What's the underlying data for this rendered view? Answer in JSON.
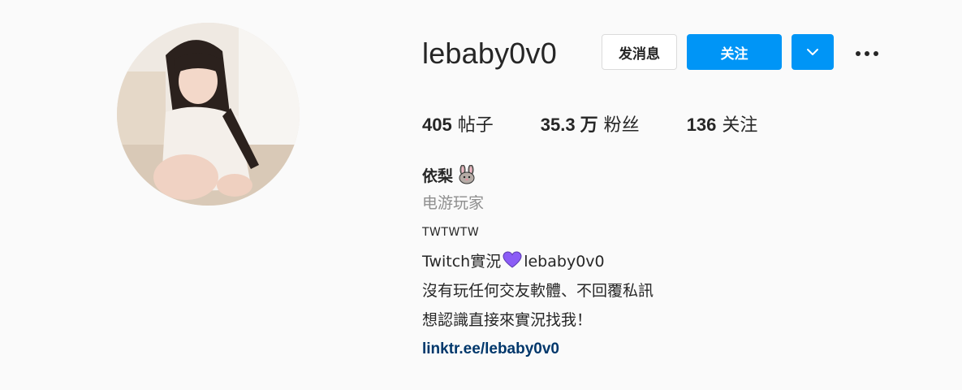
{
  "profile": {
    "username": "lebaby0v0",
    "full_name": "依梨",
    "category": "电游玩家",
    "bio_lines": {
      "line1": "TWTWTW",
      "line2_prefix": "Twitch實況",
      "line2_suffix": "lebaby0v0",
      "line3": "沒有玩任何交友軟體、不回覆私訊",
      "line4": "想認識直接來實況找我！"
    },
    "link": "linktr.ee/lebaby0v0"
  },
  "actions": {
    "message_label": "发消息",
    "follow_label": "关注"
  },
  "stats": {
    "posts_count": "405",
    "posts_label": "帖子",
    "followers_count": "35.3 万",
    "followers_label": "粉丝",
    "following_count": "136",
    "following_label": "关注"
  },
  "icons": {
    "dropdown": "chevron-down-icon",
    "more": "more-options-icon",
    "name_emoji": "rabbit-emoji-icon",
    "bio_emoji": "purple-heart-emoji-icon"
  },
  "colors": {
    "primary": "#0095f6",
    "link": "#00376b",
    "muted": "#8e8e8e",
    "heart": "#8b5cf6"
  }
}
